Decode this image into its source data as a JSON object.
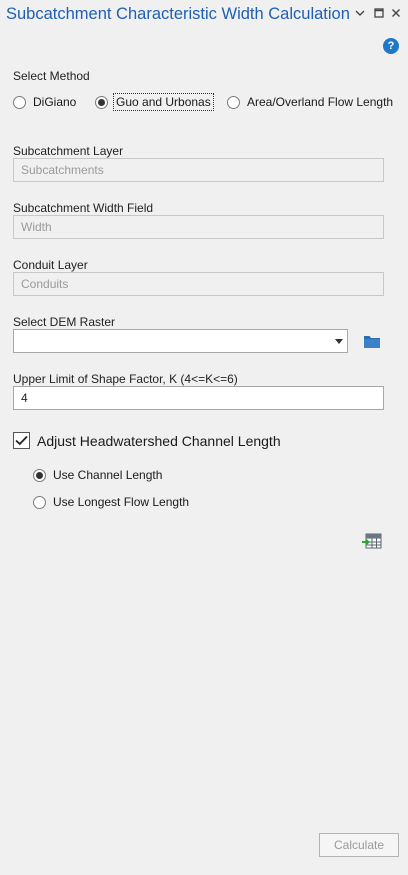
{
  "window": {
    "title": "Subcatchment Characteristic Width Calculation",
    "controls": {
      "menu_glyph": "⌄",
      "maximize_glyph": "▢",
      "close_glyph": "✕"
    }
  },
  "help": {
    "icon": "question-icon",
    "glyph": "?"
  },
  "method": {
    "label": "Select Method",
    "options": [
      {
        "label": "DiGiano",
        "checked": false
      },
      {
        "label": "Guo and Urbonas",
        "checked": true
      },
      {
        "label": "Area/Overland Flow Length",
        "checked": false
      }
    ]
  },
  "subcatchment_layer": {
    "label": "Subcatchment Layer",
    "value": "Subcatchments"
  },
  "width_field": {
    "label": "Subcatchment Width Field",
    "value": "Width"
  },
  "conduit_layer": {
    "label": "Conduit Layer",
    "value": "Conduits"
  },
  "dem": {
    "label": "Select DEM Raster",
    "value": "",
    "browse_icon": "folder-icon"
  },
  "shape_factor": {
    "label": "Upper Limit of Shape Factor, K (4<=K<=6)",
    "value": "4"
  },
  "adjust": {
    "label": "Adjust Headwatershed Channel Length",
    "checked": true,
    "options": [
      {
        "label": "Use Channel Length",
        "checked": true
      },
      {
        "label": "Use Longest Flow Length",
        "checked": false
      }
    ]
  },
  "table_icon": "table-export-icon",
  "calculate": {
    "label": "Calculate",
    "enabled": false
  },
  "colors": {
    "title": "#1f5fb4",
    "accent": "#1e78c8",
    "panel": "#f0f0f0"
  }
}
